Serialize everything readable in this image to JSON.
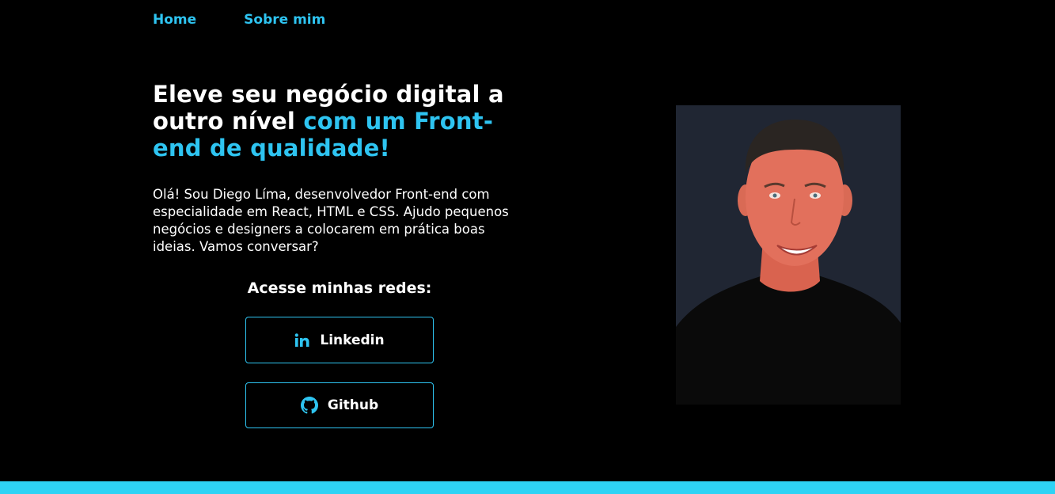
{
  "nav": {
    "items": [
      {
        "label": "Home"
      },
      {
        "label": "Sobre mim"
      }
    ]
  },
  "hero": {
    "headline_part1": "Eleve seu negócio digital a outro nível",
    "headline_part2": "com um Front-end de qualidade!",
    "intro": "Olá! Sou Diego Líma, desenvolvedor Front-end com especialidade em React, HTML e CSS. Ajudo pequenos negócios e designers a colocarem em prática boas ideias. Vamos conversar?",
    "networks_title": "Acesse minhas redes:",
    "buttons": {
      "linkedin": {
        "label": "Linkedin",
        "icon": "linkedin-icon"
      },
      "github": {
        "label": "Github",
        "icon": "github-icon"
      }
    }
  },
  "colors": {
    "background": "#000000",
    "accent": "#2ec4f1",
    "bottom_bar": "#2ed3f5",
    "photo_background": "#202633"
  }
}
